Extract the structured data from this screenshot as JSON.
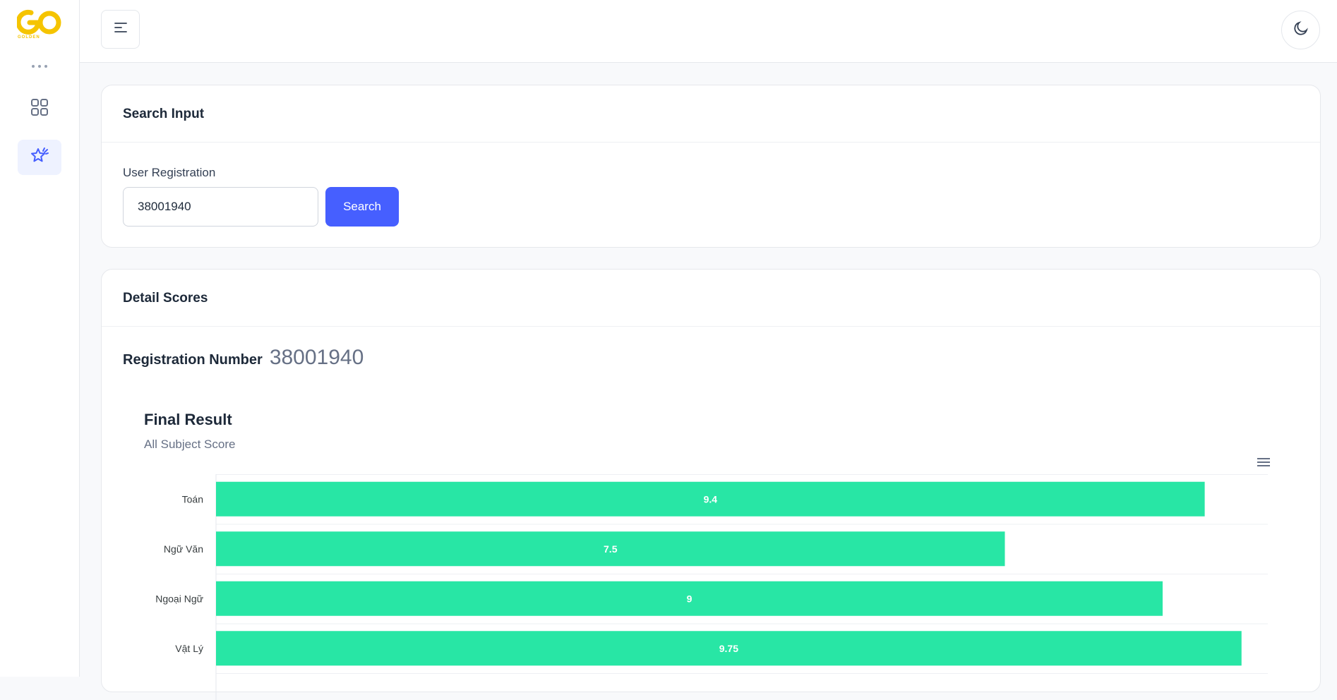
{
  "sidebar": {
    "logo_alt": "GO",
    "logo_subtext": "GOLDEN",
    "items": [
      {
        "name": "dashboard",
        "icon": "grid-icon"
      },
      {
        "name": "scores",
        "icon": "star-sparkle-icon"
      }
    ]
  },
  "colors": {
    "accent": "#465fff",
    "bar": "#28e6a5",
    "logo": "#f5c400"
  },
  "search_card": {
    "title": "Search Input",
    "field_label": "User Registration",
    "input_value": "38001940",
    "button_label": "Search"
  },
  "detail_card": {
    "title": "Detail Scores",
    "registration_label": "Registration Number",
    "registration_value": "38001940"
  },
  "chart_data": {
    "type": "bar",
    "orientation": "horizontal",
    "title": "Final Result",
    "subtitle": "All Subject Score",
    "categories": [
      "Toán",
      "Ngữ Văn",
      "Ngoại Ngữ",
      "Vật Lý"
    ],
    "values": [
      9.4,
      7.5,
      9,
      9.75
    ],
    "xlim": [
      0,
      10
    ],
    "grid": true
  }
}
